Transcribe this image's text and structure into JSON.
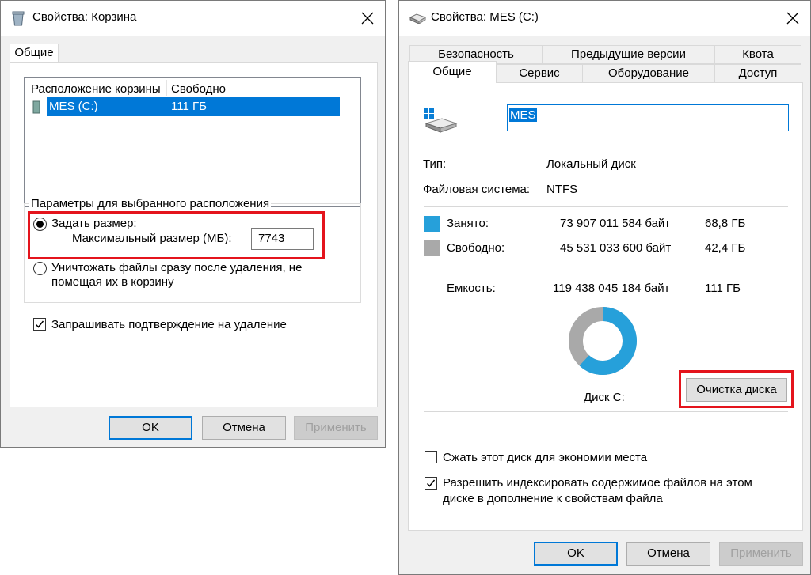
{
  "left_window": {
    "title": "Свойства: Корзина",
    "tab": "Общие",
    "list_headers": [
      "Расположение корзины",
      "Свободно"
    ],
    "list_row": {
      "location": "MES (C:)",
      "free": "111 ГБ"
    },
    "group_label": "Параметры для выбранного расположения",
    "radio_custom": "Задать размер:",
    "max_size_label": "Максимальный размер (МБ):",
    "max_size_value": "7743",
    "radio_delete": "Уничтожать файлы сразу после удаления, не",
    "radio_delete_line2": "помещая их в корзину",
    "confirm_checkbox": "Запрашивать подтверждение на удаление",
    "buttons": {
      "ok": "OK",
      "cancel": "Отмена",
      "apply": "Применить"
    }
  },
  "right_window": {
    "title": "Свойства: MES (C:)",
    "tabs_top": [
      "Безопасность",
      "Предыдущие версии",
      "Квота"
    ],
    "tabs_bottom": [
      "Общие",
      "Сервис",
      "Оборудование",
      "Доступ"
    ],
    "drive_name": "MES",
    "type_label": "Тип:",
    "type_value": "Локальный диск",
    "fs_label": "Файловая система:",
    "fs_value": "NTFS",
    "used_label": "Занято:",
    "used_bytes": "73 907 011 584 байт",
    "used_gb": "68,8 ГБ",
    "free_label": "Свободно:",
    "free_bytes": "45 531 033 600 байт",
    "free_gb": "42,4 ГБ",
    "capacity_label": "Емкость:",
    "capacity_bytes": "119 438 045 184 байт",
    "capacity_gb": "111 ГБ",
    "disk_label": "Диск C:",
    "cleanup_button": "Очистка диска",
    "compress_checkbox": "Сжать этот диск для экономии места",
    "index_checkbox": "Разрешить индексировать содержимое файлов на этом",
    "index_checkbox_line2": "диске в дополнение к свойствам файла",
    "buttons": {
      "ok": "OK",
      "cancel": "Отмена",
      "apply": "Применить"
    },
    "colors": {
      "used": "#26a0da",
      "free": "#a9a9a9"
    },
    "used_fraction": 0.619
  }
}
